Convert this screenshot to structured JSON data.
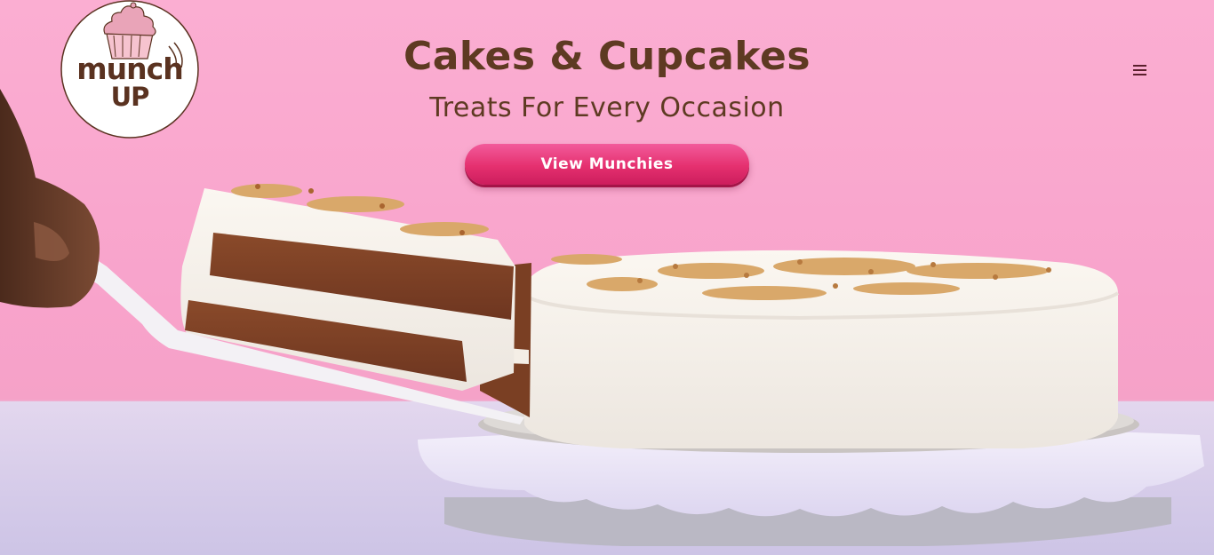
{
  "brand": {
    "logo_line1": "munch",
    "logo_line2": "UP"
  },
  "hero": {
    "headline": "Cakes & Cupcakes",
    "subheadline": "Treats For Every Occasion",
    "cta_label": "View Munchies"
  },
  "nav": {
    "menu_icon": "hamburger-menu-icon"
  },
  "colors": {
    "background_pink": "#f8a3cb",
    "heading_brown": "#5e3a22",
    "button_pink": "#e5306f",
    "button_text": "#ffffff"
  }
}
